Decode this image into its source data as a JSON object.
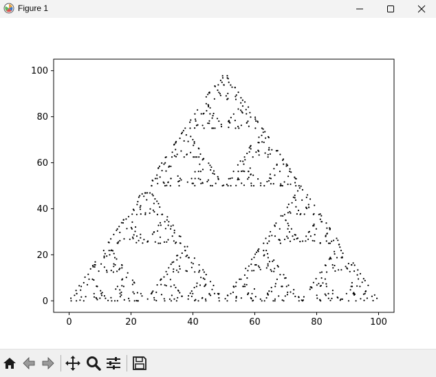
{
  "window": {
    "title": "Figure 1",
    "icon": "matplotlib-icon",
    "controls": [
      "minimize-icon",
      "maximize-icon",
      "close-icon"
    ]
  },
  "toolbar": {
    "buttons": [
      "home-icon",
      "back-icon",
      "forward-icon",
      "pan-icon",
      "zoom-icon",
      "configure-subplots-icon",
      "save-icon"
    ]
  },
  "chart_data": {
    "type": "scatter",
    "description_kind": "sierpinski-triangle-chaos-game",
    "vertices": [
      [
        0,
        0
      ],
      [
        100,
        0
      ],
      [
        50,
        100
      ]
    ],
    "recursion_depth": 5,
    "marker_color": "#000000",
    "xlim": [
      -5,
      105
    ],
    "ylim": [
      -5,
      105
    ],
    "x_ticks": [
      0,
      20,
      40,
      60,
      80,
      100
    ],
    "y_ticks": [
      0,
      20,
      40,
      60,
      80,
      100
    ],
    "x_tick_labels": [
      "0",
      "20",
      "40",
      "60",
      "80",
      "100"
    ],
    "y_tick_labels": [
      "0",
      "20",
      "40",
      "60",
      "80",
      "100"
    ],
    "title": "",
    "xlabel": "",
    "ylabel": "",
    "grid": false
  }
}
